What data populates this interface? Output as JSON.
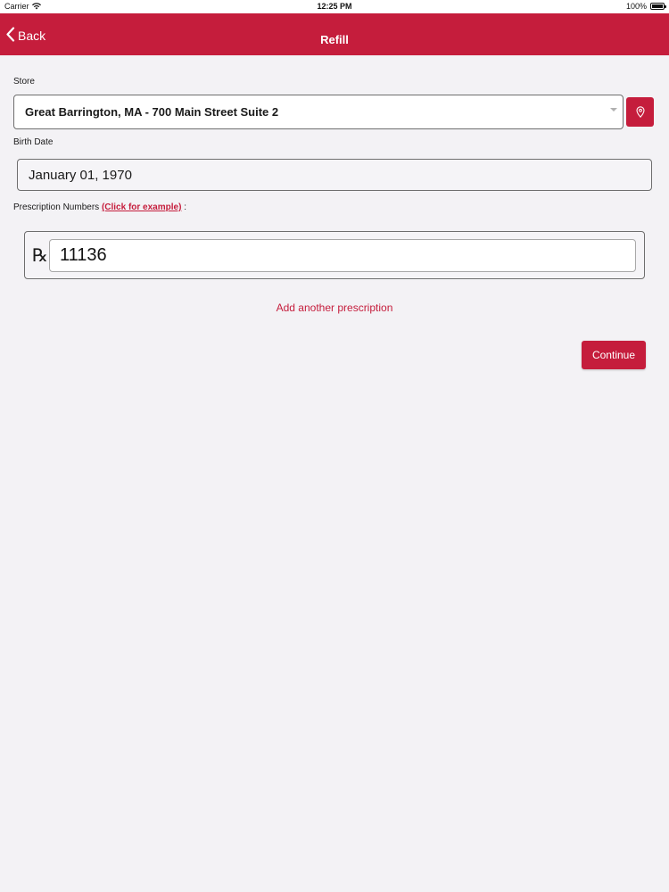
{
  "status_bar": {
    "carrier": "Carrier",
    "time": "12:25 PM",
    "battery": "100%"
  },
  "nav": {
    "back_label": "Back",
    "title": "Refill"
  },
  "form": {
    "store_label": "Store",
    "store_value": "Great Barrington, MA - 700 Main Street Suite 2",
    "birth_label": "Birth Date",
    "birth_value": "January 01, 1970",
    "rx_label": "Prescription Numbers",
    "rx_example_link": "(Click for example)",
    "rx_label_suffix": ":",
    "rx_symbol": "℞",
    "rx_value": "11136",
    "add_prescription": "Add another prescription",
    "continue_label": "Continue"
  },
  "colors": {
    "brand": "#c51d3c",
    "background": "#f3f2f5"
  },
  "icons": {
    "back": "chevron-left-icon",
    "locate": "location-pin-icon",
    "wifi": "wifi-icon",
    "battery": "battery-icon",
    "dropdown": "caret-down-icon"
  }
}
